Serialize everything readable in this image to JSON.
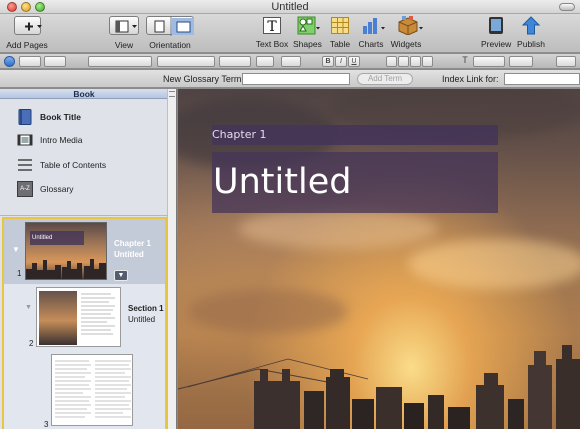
{
  "window": {
    "title": "Untitled"
  },
  "toolbar": {
    "add_pages": "Add Pages",
    "view": "View",
    "orientation": "Orientation",
    "text_box": "Text Box",
    "shapes": "Shapes",
    "table": "Table",
    "charts": "Charts",
    "widgets": "Widgets",
    "preview": "Preview",
    "publish": "Publish"
  },
  "formatbar": {
    "bold": "B",
    "italic": "I",
    "underline": "U",
    "text_icon": "T"
  },
  "glossary": {
    "new_term_label": "New Glossary Term",
    "new_term_value": "",
    "add_term": "Add Term",
    "index_link_label": "Index Link for:",
    "index_link_value": ""
  },
  "sidebar": {
    "header": "Book",
    "items": [
      {
        "label": "Book Title",
        "icon": "book-icon"
      },
      {
        "label": "Intro Media",
        "icon": "film-icon"
      },
      {
        "label": "Table of Contents",
        "icon": "list-icon"
      },
      {
        "label": "Glossary",
        "icon": "a-z-icon"
      }
    ],
    "glossary_icon_text": "A-Z",
    "pages": [
      {
        "num": "1",
        "title": "Chapter 1",
        "subtitle": "Untitled",
        "thumb_title": "Untitled"
      },
      {
        "num": "2",
        "title": "Section 1",
        "subtitle": "Untitled"
      },
      {
        "num": "3"
      }
    ]
  },
  "canvas": {
    "chapter_label": "Chapter 1",
    "title": "Untitled"
  },
  "colors": {
    "selection_border": "#e9c640",
    "chapter_bar": "#443458",
    "sidebar_bg": "#dfe3e9"
  }
}
